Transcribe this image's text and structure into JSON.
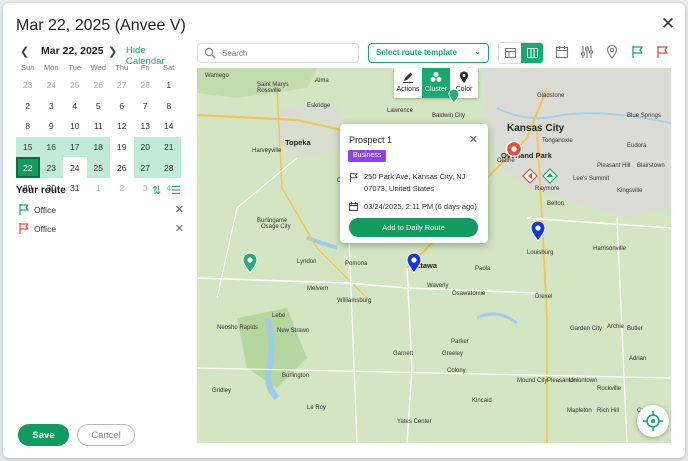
{
  "modal": {
    "title": "Mar 22, 2025 (Anvee V)"
  },
  "calendar": {
    "month_label": "Mar 22, 2025",
    "hide_label": "Hide Calendar",
    "prev_icon": "chevron-left",
    "next_icon": "chevron-right",
    "weekdays": [
      "Sun",
      "Mon",
      "Tue",
      "Wed",
      "Thu",
      "Fri",
      "Sat"
    ],
    "days": [
      {
        "d": "23",
        "s": "muted"
      },
      {
        "d": "24",
        "s": "muted"
      },
      {
        "d": "25",
        "s": "muted"
      },
      {
        "d": "26",
        "s": "muted"
      },
      {
        "d": "27",
        "s": "muted"
      },
      {
        "d": "28",
        "s": "muted"
      },
      {
        "d": "1",
        "s": ""
      },
      {
        "d": "2",
        "s": ""
      },
      {
        "d": "3",
        "s": ""
      },
      {
        "d": "4",
        "s": ""
      },
      {
        "d": "5",
        "s": ""
      },
      {
        "d": "6",
        "s": ""
      },
      {
        "d": "7",
        "s": ""
      },
      {
        "d": "8",
        "s": ""
      },
      {
        "d": "8",
        "s": ""
      },
      {
        "d": "9",
        "s": ""
      },
      {
        "d": "10",
        "s": ""
      },
      {
        "d": "11",
        "s": ""
      },
      {
        "d": "12",
        "s": ""
      },
      {
        "d": "13",
        "s": ""
      },
      {
        "d": "14",
        "s": ""
      },
      {
        "d": "15",
        "s": "range"
      },
      {
        "d": "16",
        "s": "range"
      },
      {
        "d": "17",
        "s": "range"
      },
      {
        "d": "18",
        "s": "range"
      },
      {
        "d": "19",
        "s": ""
      },
      {
        "d": "20",
        "s": "range"
      },
      {
        "d": "21",
        "s": "range"
      },
      {
        "d": "22",
        "s": "sel"
      },
      {
        "d": "23",
        "s": "range"
      },
      {
        "d": "24",
        "s": ""
      },
      {
        "d": "25",
        "s": "range"
      },
      {
        "d": "26",
        "s": ""
      },
      {
        "d": "27",
        "s": "range"
      },
      {
        "d": "28",
        "s": "range"
      },
      {
        "d": "29",
        "s": ""
      },
      {
        "d": "30",
        "s": ""
      },
      {
        "d": "31",
        "s": ""
      },
      {
        "d": "1",
        "s": "muted"
      },
      {
        "d": "2",
        "s": "muted"
      },
      {
        "d": "3",
        "s": "muted"
      },
      {
        "d": "4",
        "s": "muted"
      }
    ]
  },
  "route": {
    "title": "Your route",
    "items": [
      {
        "label": "Office",
        "flag_color": "#19a970"
      },
      {
        "label": "Office",
        "flag_color": "#e74c3c"
      }
    ]
  },
  "actions": {
    "save": "Save",
    "cancel": "Cancel"
  },
  "search": {
    "placeholder": "Search"
  },
  "template_select": {
    "label": "Select route template"
  },
  "map_toolbar": {
    "items": [
      {
        "label": "Actions",
        "icon": "pencil-icon"
      },
      {
        "label": "Cluster",
        "icon": "cluster-icon"
      },
      {
        "label": "Color",
        "icon": "pin-icon"
      }
    ]
  },
  "popup": {
    "title": "Prospect 1",
    "tag": "Business",
    "address": "250 Park Ave, Kansas City, NJ 07073, United States",
    "date": "03/24/2025, 2:11 PM (6 days ago)",
    "button": "Add to Daily Route"
  },
  "map": {
    "labels": [
      {
        "t": "Kansas City",
        "c": "big"
      },
      {
        "t": "Overland Park",
        "c": "mid"
      },
      {
        "t": "Topeka",
        "c": "mid"
      },
      {
        "t": "Ottawa",
        "c": "mid"
      },
      {
        "t": "Wamego",
        "c": ""
      },
      {
        "t": "Rossville",
        "c": ""
      },
      {
        "t": "Saint Marys",
        "c": ""
      },
      {
        "t": "Alma",
        "c": ""
      },
      {
        "t": "Eskridge",
        "c": ""
      },
      {
        "t": "Harveyville",
        "c": ""
      },
      {
        "t": "Burlingame",
        "c": ""
      },
      {
        "t": "Osage City",
        "c": ""
      },
      {
        "t": "Lyndon",
        "c": ""
      },
      {
        "t": "Pomona",
        "c": ""
      },
      {
        "t": "Melvern",
        "c": ""
      },
      {
        "t": "Williamsburg",
        "c": ""
      },
      {
        "t": "Waverly",
        "c": ""
      },
      {
        "t": "Lebo",
        "c": ""
      },
      {
        "t": "Neosho Rapids",
        "c": ""
      },
      {
        "t": "New Strawn",
        "c": ""
      },
      {
        "t": "Burlington",
        "c": ""
      },
      {
        "t": "Gridley",
        "c": ""
      },
      {
        "t": "Le Roy",
        "c": ""
      },
      {
        "t": "Yates Center",
        "c": ""
      },
      {
        "t": "Garnett",
        "c": ""
      },
      {
        "t": "Greeley",
        "c": ""
      },
      {
        "t": "Parker",
        "c": ""
      },
      {
        "t": "Osawatomie",
        "c": ""
      },
      {
        "t": "Paola",
        "c": ""
      },
      {
        "t": "Louisburg",
        "c": ""
      },
      {
        "t": "Drexel",
        "c": ""
      },
      {
        "t": "Harrisonville",
        "c": ""
      },
      {
        "t": "Garden City",
        "c": ""
      },
      {
        "t": "Archie",
        "c": ""
      },
      {
        "t": "Butler",
        "c": ""
      },
      {
        "t": "Adrian",
        "c": ""
      },
      {
        "t": "Belton",
        "c": ""
      },
      {
        "t": "Raymore",
        "c": ""
      },
      {
        "t": "Lee's Summit",
        "c": ""
      },
      {
        "t": "Pleasant Hill",
        "c": ""
      },
      {
        "t": "Blue Springs",
        "c": ""
      },
      {
        "t": "Gladstone",
        "c": ""
      },
      {
        "t": "Olathe",
        "c": ""
      },
      {
        "t": "Gardner",
        "c": ""
      },
      {
        "t": "Wellsville",
        "c": ""
      },
      {
        "t": "Lawrence",
        "c": ""
      },
      {
        "t": "Baldwin City",
        "c": ""
      },
      {
        "t": "Mound City",
        "c": ""
      },
      {
        "t": "Pleasanton",
        "c": ""
      },
      {
        "t": "Colony",
        "c": ""
      },
      {
        "t": "Kincaid",
        "c": ""
      },
      {
        "t": "Mapleton",
        "c": ""
      },
      {
        "t": "Carbondale",
        "c": ""
      },
      {
        "t": "Uniontown",
        "c": ""
      },
      {
        "t": "Rich Hill",
        "c": ""
      },
      {
        "t": "Appleton City",
        "c": ""
      },
      {
        "t": "Creighton",
        "c": ""
      },
      {
        "t": "Rockville",
        "c": ""
      },
      {
        "t": "Blairstown",
        "c": ""
      },
      {
        "t": "Holden",
        "c": ""
      },
      {
        "t": "Kingsville",
        "c": ""
      },
      {
        "t": "Tonganoxie",
        "c": ""
      },
      {
        "t": "Eudora",
        "c": ""
      }
    ]
  },
  "colors": {
    "accent": "#19a970",
    "accent_dark": "#139a5e",
    "tag": "#8f42e3",
    "flag_red": "#e74c3c"
  }
}
